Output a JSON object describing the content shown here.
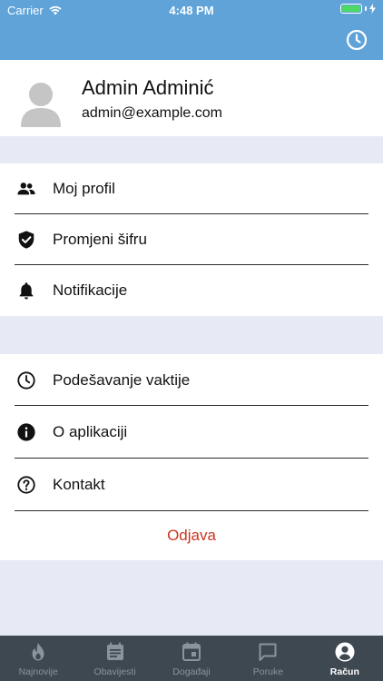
{
  "status_bar": {
    "carrier": "Carrier",
    "time": "4:48 PM"
  },
  "colors": {
    "accent": "#5fa3d9",
    "logout": "#c9361f",
    "tabbar": "#3e4850",
    "section_bg": "#e7eaf4"
  },
  "header": {
    "action_icon": "clock-icon"
  },
  "profile": {
    "name": "Admin Adminić",
    "email": "admin@example.com"
  },
  "menu_group_1": [
    {
      "label": "Moj profil",
      "icon": "people-icon"
    },
    {
      "label": "Promjeni šifru",
      "icon": "shield-check-icon"
    },
    {
      "label": "Notifikacije",
      "icon": "bell-icon"
    }
  ],
  "menu_group_2": [
    {
      "label": "Podešavanje vaktije",
      "icon": "clock-icon"
    },
    {
      "label": "O aplikaciji",
      "icon": "info-icon"
    },
    {
      "label": "Kontakt",
      "icon": "help-icon"
    }
  ],
  "logout_label": "Odjava",
  "tabs": [
    {
      "label": "Najnovije",
      "icon": "fire-icon",
      "active": false
    },
    {
      "label": "Obavijesti",
      "icon": "newspaper-icon",
      "active": false
    },
    {
      "label": "Događaji",
      "icon": "calendar-icon",
      "active": false
    },
    {
      "label": "Poruke",
      "icon": "chat-icon",
      "active": false
    },
    {
      "label": "Račun",
      "icon": "account-icon",
      "active": true
    }
  ]
}
